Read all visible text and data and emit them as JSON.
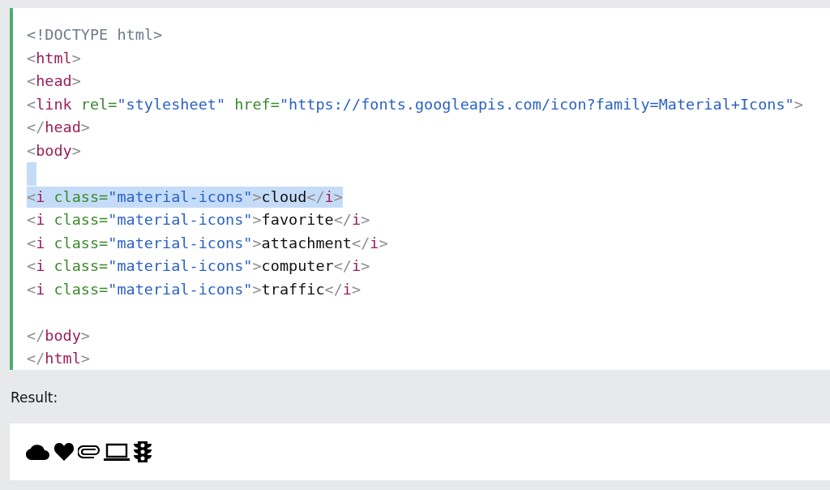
{
  "code_lines": [
    {
      "selected": false,
      "tokens": [
        {
          "kind": "doctype",
          "text": "<!DOCTYPE html>"
        }
      ]
    },
    {
      "selected": false,
      "tokens": [
        {
          "kind": "bracket",
          "text": "<"
        },
        {
          "kind": "tag",
          "text": "html"
        },
        {
          "kind": "bracket",
          "text": ">"
        }
      ]
    },
    {
      "selected": false,
      "tokens": [
        {
          "kind": "bracket",
          "text": "<"
        },
        {
          "kind": "tag",
          "text": "head"
        },
        {
          "kind": "bracket",
          "text": ">"
        }
      ]
    },
    {
      "selected": false,
      "tokens": [
        {
          "kind": "bracket",
          "text": "<"
        },
        {
          "kind": "tag",
          "text": "link"
        },
        {
          "kind": "attr",
          "text": "rel="
        },
        {
          "kind": "string",
          "text": "\"stylesheet\""
        },
        {
          "kind": "attr",
          "text": "href="
        },
        {
          "kind": "string",
          "text": "\"https://fonts.googleapis.com/icon?family=Material+Icons\""
        },
        {
          "kind": "bracket",
          "text": ">"
        }
      ]
    },
    {
      "selected": false,
      "tokens": [
        {
          "kind": "bracket",
          "text": "</"
        },
        {
          "kind": "tag",
          "text": "head"
        },
        {
          "kind": "bracket",
          "text": ">"
        }
      ]
    },
    {
      "selected": false,
      "tokens": [
        {
          "kind": "bracket",
          "text": "<"
        },
        {
          "kind": "tag",
          "text": "body"
        },
        {
          "kind": "bracket",
          "text": ">"
        }
      ]
    },
    {
      "selected": true
    },
    {
      "selected": true,
      "tokens": [
        {
          "kind": "bracket",
          "text": "<"
        },
        {
          "kind": "tag",
          "text": "i"
        },
        {
          "kind": "attr",
          "text": "class="
        },
        {
          "kind": "string",
          "text": "\"material-icons\""
        },
        {
          "kind": "bracket",
          "text": ">"
        },
        {
          "kind": "text",
          "text": "cloud"
        },
        {
          "kind": "bracket",
          "text": "</"
        },
        {
          "kind": "tag",
          "text": "i"
        },
        {
          "kind": "bracket",
          "text": ">"
        }
      ]
    },
    {
      "selected": false,
      "tokens": [
        {
          "kind": "bracket",
          "text": "<"
        },
        {
          "kind": "tag",
          "text": "i"
        },
        {
          "kind": "attr",
          "text": "class="
        },
        {
          "kind": "string",
          "text": "\"material-icons\""
        },
        {
          "kind": "bracket",
          "text": ">"
        },
        {
          "kind": "text",
          "text": "favorite"
        },
        {
          "kind": "bracket",
          "text": "</"
        },
        {
          "kind": "tag",
          "text": "i"
        },
        {
          "kind": "bracket",
          "text": ">"
        }
      ]
    },
    {
      "selected": false,
      "tokens": [
        {
          "kind": "bracket",
          "text": "<"
        },
        {
          "kind": "tag",
          "text": "i"
        },
        {
          "kind": "attr",
          "text": "class="
        },
        {
          "kind": "string",
          "text": "\"material-icons\""
        },
        {
          "kind": "bracket",
          "text": ">"
        },
        {
          "kind": "text",
          "text": "attachment"
        },
        {
          "kind": "bracket",
          "text": "</"
        },
        {
          "kind": "tag",
          "text": "i"
        },
        {
          "kind": "bracket",
          "text": ">"
        }
      ]
    },
    {
      "selected": false,
      "tokens": [
        {
          "kind": "bracket",
          "text": "<"
        },
        {
          "kind": "tag",
          "text": "i"
        },
        {
          "kind": "attr",
          "text": "class="
        },
        {
          "kind": "string",
          "text": "\"material-icons\""
        },
        {
          "kind": "bracket",
          "text": ">"
        },
        {
          "kind": "text",
          "text": "computer"
        },
        {
          "kind": "bracket",
          "text": "</"
        },
        {
          "kind": "tag",
          "text": "i"
        },
        {
          "kind": "bracket",
          "text": ">"
        }
      ]
    },
    {
      "selected": false,
      "tokens": [
        {
          "kind": "bracket",
          "text": "<"
        },
        {
          "kind": "tag",
          "text": "i"
        },
        {
          "kind": "attr",
          "text": "class="
        },
        {
          "kind": "string",
          "text": "\"material-icons\""
        },
        {
          "kind": "bracket",
          "text": ">"
        },
        {
          "kind": "text",
          "text": "traffic"
        },
        {
          "kind": "bracket",
          "text": "</"
        },
        {
          "kind": "tag",
          "text": "i"
        },
        {
          "kind": "bracket",
          "text": ">"
        }
      ]
    },
    {
      "selected": false
    },
    {
      "selected": false,
      "tokens": [
        {
          "kind": "bracket",
          "text": "</"
        },
        {
          "kind": "tag",
          "text": "body"
        },
        {
          "kind": "bracket",
          "text": ">"
        }
      ]
    },
    {
      "selected": false,
      "tokens": [
        {
          "kind": "bracket",
          "text": "</"
        },
        {
          "kind": "tag",
          "text": "html"
        },
        {
          "kind": "bracket",
          "text": ">"
        }
      ]
    }
  ],
  "result_label": "Result:"
}
